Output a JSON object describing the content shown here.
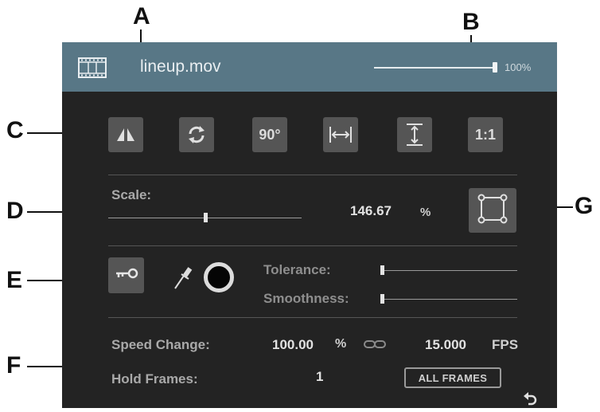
{
  "callouts": [
    "A",
    "B",
    "C",
    "D",
    "E",
    "F",
    "G"
  ],
  "header": {
    "title": "lineup.mov",
    "icon": "film-icon",
    "opacity": {
      "value": 1.0,
      "label": "100%"
    },
    "bg_color": "#587786"
  },
  "toolbar": {
    "buttons": [
      {
        "name": "flip-horizontal-button",
        "icon": "flip-horizontal-icon"
      },
      {
        "name": "rotate-button",
        "icon": "rotate-icon"
      },
      {
        "name": "rotate-90-button",
        "label": "90°"
      },
      {
        "name": "fit-width-button",
        "icon": "fit-width-icon"
      },
      {
        "name": "fit-height-button",
        "icon": "fit-height-icon"
      },
      {
        "name": "actual-size-button",
        "label": "1:1"
      }
    ]
  },
  "scale": {
    "label": "Scale:",
    "value": "146.67",
    "unit": "%",
    "slider_position": 0.5,
    "button_icon": "transform-icon"
  },
  "key": {
    "icon": "key-icon",
    "eyedropper_icon": "eyedropper-icon",
    "key_color": "#050505",
    "tolerance_label": "Tolerance:",
    "tolerance_value": 0.0,
    "smoothness_label": "Smoothness:",
    "smoothness_value": 0.0
  },
  "speed": {
    "speed_label": "Speed Change:",
    "speed_value": "100.00",
    "speed_unit": "%",
    "link_icon": "link-icon",
    "fps_value": "15.000",
    "fps_unit": "FPS",
    "hold_label": "Hold Frames:",
    "hold_value": "1",
    "all_frames_label": "ALL FRAMES",
    "reset_icon": "reset-icon"
  }
}
